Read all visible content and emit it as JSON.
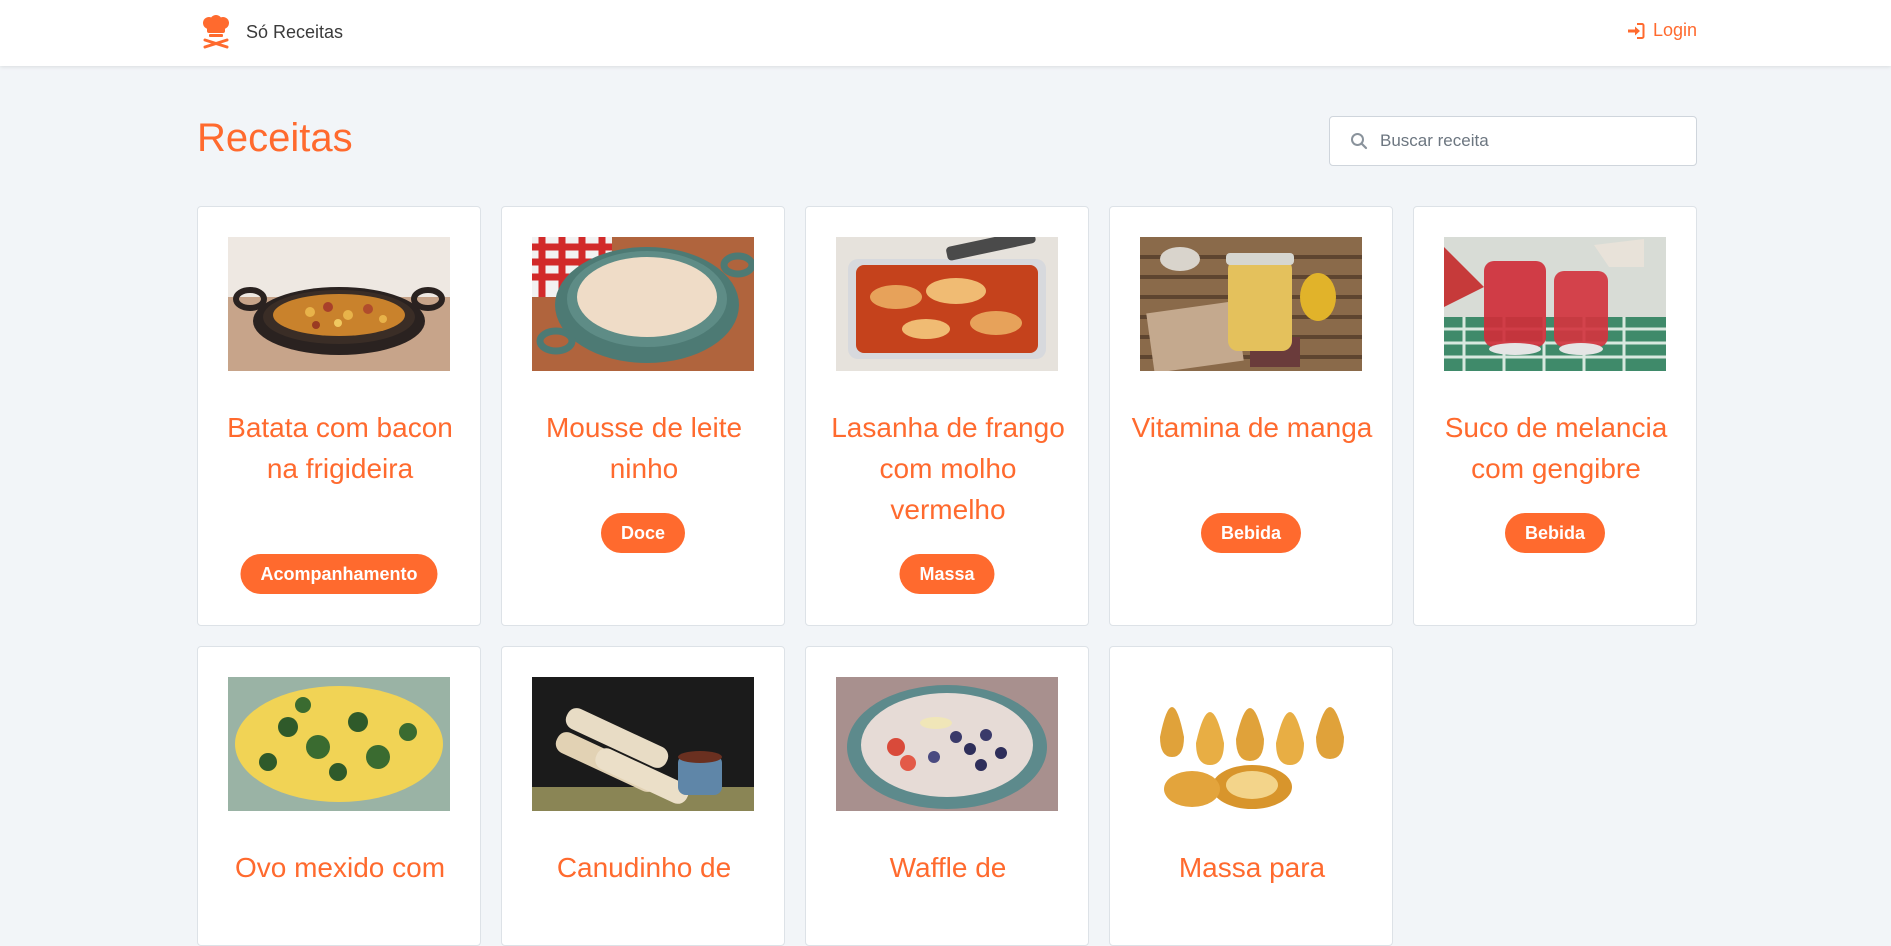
{
  "app": {
    "name": "Só Receitas",
    "brand_icon": "chef-hat-icon"
  },
  "nav": {
    "login_label": "Login",
    "login_icon": "sign-in-icon"
  },
  "main": {
    "title": "Receitas",
    "search": {
      "placeholder": "Buscar receita",
      "value": "",
      "icon": "search-icon"
    }
  },
  "colors": {
    "accent": "#ff6a2e",
    "background": "#f2f5f8",
    "card": "#ffffff"
  },
  "recipes": [
    {
      "title": "Batata com bacon na frigideira",
      "category": "Acompanhamento"
    },
    {
      "title": "Mousse de leite ninho",
      "category": "Doce"
    },
    {
      "title": "Lasanha de frango com molho vermelho",
      "category": "Massa"
    },
    {
      "title": "Vitamina de manga",
      "category": "Bebida"
    },
    {
      "title": "Suco de melancia com gengibre",
      "category": "Bebida"
    },
    {
      "title": "Ovo mexido com"
    },
    {
      "title": "Canudinho de"
    },
    {
      "title": "Waffle de"
    },
    {
      "title": "Massa para"
    }
  ]
}
